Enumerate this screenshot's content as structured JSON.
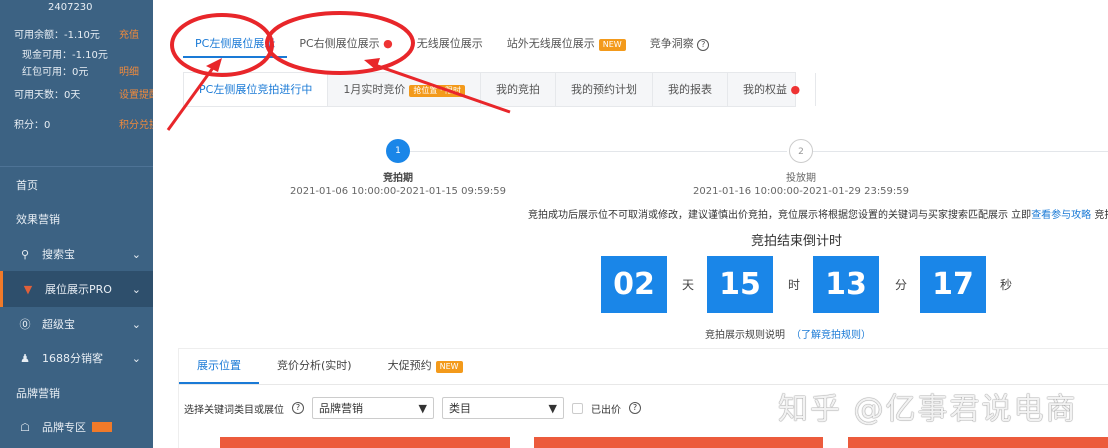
{
  "sidebar": {
    "account_id": "2407230",
    "balance": {
      "label": "可用余额：-1.10元",
      "action": "充值"
    },
    "cash": {
      "label": "现金可用：-1.10元"
    },
    "redpacket": {
      "label": "红包可用：0元",
      "action": "明细"
    },
    "days": {
      "label": "可用天数：0天",
      "action": "设置提醒"
    },
    "points": {
      "label": "积分：0",
      "action": "积分兑换"
    },
    "nav": [
      {
        "label": "首页"
      },
      {
        "label": "效果营销"
      },
      {
        "label": "搜索宝",
        "icon": "search-icon"
      },
      {
        "label": "展位展示PRO",
        "icon": "basket-icon"
      },
      {
        "label": "超级宝",
        "icon": "coin-icon"
      },
      {
        "label": "1688分销客",
        "icon": "users-icon"
      },
      {
        "label": "品牌营销"
      },
      {
        "label": "品牌专区",
        "icon": "trophy-icon"
      }
    ]
  },
  "main": {
    "tabs": [
      {
        "label": "PC左侧展位展示"
      },
      {
        "label": "PC右侧展位展示"
      },
      {
        "label": "无线展位展示"
      },
      {
        "label": "站外无线展位展示",
        "badge": "NEW"
      },
      {
        "label": "竞争洞察"
      }
    ],
    "subtabs": [
      {
        "label": "PC左侧展位竞拍进行中"
      },
      {
        "label": "1月实时竞价",
        "badge": "抢位置 · 限时"
      },
      {
        "label": "我的竞拍"
      },
      {
        "label": "我的预约计划"
      },
      {
        "label": "我的报表"
      },
      {
        "label": "我的权益"
      }
    ],
    "steps": [
      {
        "num": "1",
        "name": "竞拍期",
        "range": "2021-01-06 10:00:00-2021-01-15 09:59:59"
      },
      {
        "num": "2",
        "name": "投放期",
        "range": "2021-01-16 10:00:00-2021-01-29 23:59:59"
      }
    ],
    "notice": "竞拍成功后展示位不可取消或修改，建议谨慎出价竞拍，竞位展示将根据您设置的关键词与买家搜索匹配展示 立即",
    "notice_link": "查看参与攻略",
    "notice_tip": "竞拍技巧",
    "countdown": {
      "title": "竞拍结束倒计时",
      "days": "02",
      "days_unit": "天",
      "hours": "15",
      "hours_unit": "时",
      "minutes": "13",
      "minutes_unit": "分",
      "seconds": "17",
      "seconds_unit": "秒"
    },
    "rule_text": "竞拍展示规则说明",
    "rule_link": "（了解竞拍规则）",
    "bottom_tabs": [
      {
        "label": "展示位置"
      },
      {
        "label": "竞价分析(实时)"
      },
      {
        "label": "大促预约",
        "badge": "NEW"
      }
    ],
    "filter": {
      "label": "选择关键词类目或展位",
      "select1": "品牌营销",
      "select2": "类目",
      "checkbox": "已出价"
    },
    "watermark": "知乎 @亿事君说电商"
  },
  "colors": {
    "sidebar": "#3c6283",
    "accent": "#1a7ad6",
    "countdown": "#1a86e8",
    "annotation": "#e8262a"
  }
}
